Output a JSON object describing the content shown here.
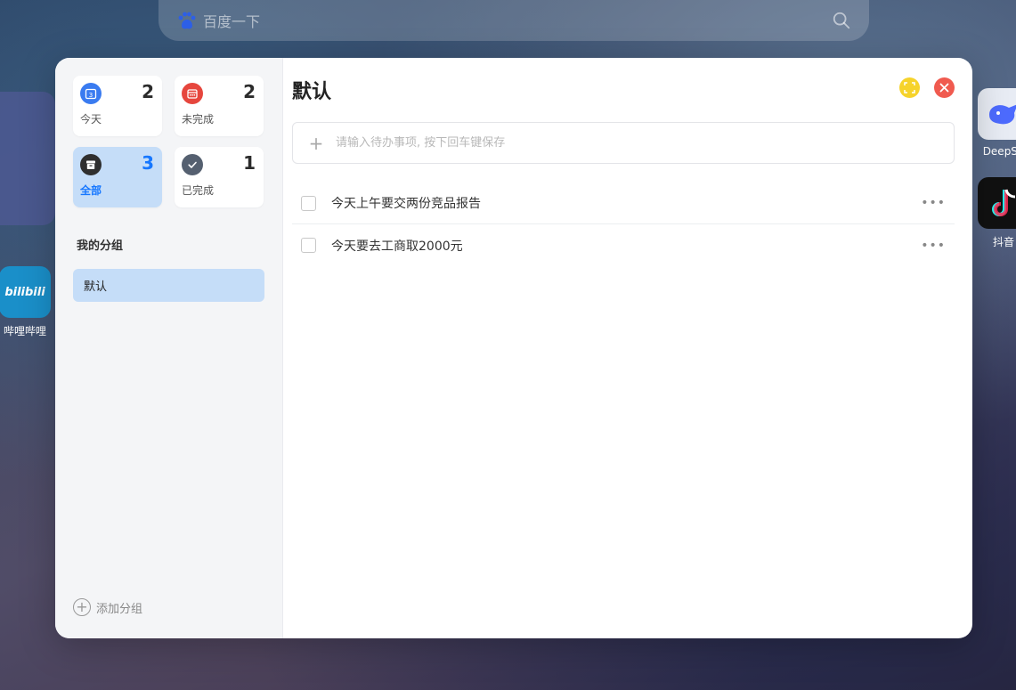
{
  "background": {
    "search_placeholder": "百度一下",
    "desktop_icons": [
      {
        "name": "bilibili",
        "tile_text": "bilibili",
        "caption": "哔哩哔哩"
      },
      {
        "name": "deepseek",
        "caption": "DeepSe"
      },
      {
        "name": "douyin",
        "caption": "抖音"
      }
    ]
  },
  "sidebar": {
    "stats": [
      {
        "key": "today",
        "label": "今天",
        "count": "2",
        "icon": "calendar-icon",
        "color": "#3a7bf0",
        "icon_text": "3"
      },
      {
        "key": "incomplete",
        "label": "未完成",
        "count": "2",
        "icon": "calendar-icon",
        "color": "#e6463d"
      },
      {
        "key": "all",
        "label": "全部",
        "count": "3",
        "icon": "archive-icon",
        "color": "#2f2f2f",
        "active": true
      },
      {
        "key": "done",
        "label": "已完成",
        "count": "1",
        "icon": "check-icon",
        "color": "#556070"
      }
    ],
    "groups_title": "我的分组",
    "groups": [
      {
        "label": "默认",
        "active": true
      }
    ],
    "add_group_label": "添加分组"
  },
  "main": {
    "title": "默认",
    "input_placeholder": "请输入待办事项, 按下回车键保存",
    "todos": [
      {
        "text": "今天上午要交两份竞品报告",
        "done": false
      },
      {
        "text": "今天要去工商取2000元",
        "done": false
      }
    ],
    "more_label": "•••"
  },
  "colors": {
    "accent": "#1677ff",
    "active_bg": "#c5ddf8",
    "maximize": "#f6d32b",
    "close": "#f05a4f"
  }
}
